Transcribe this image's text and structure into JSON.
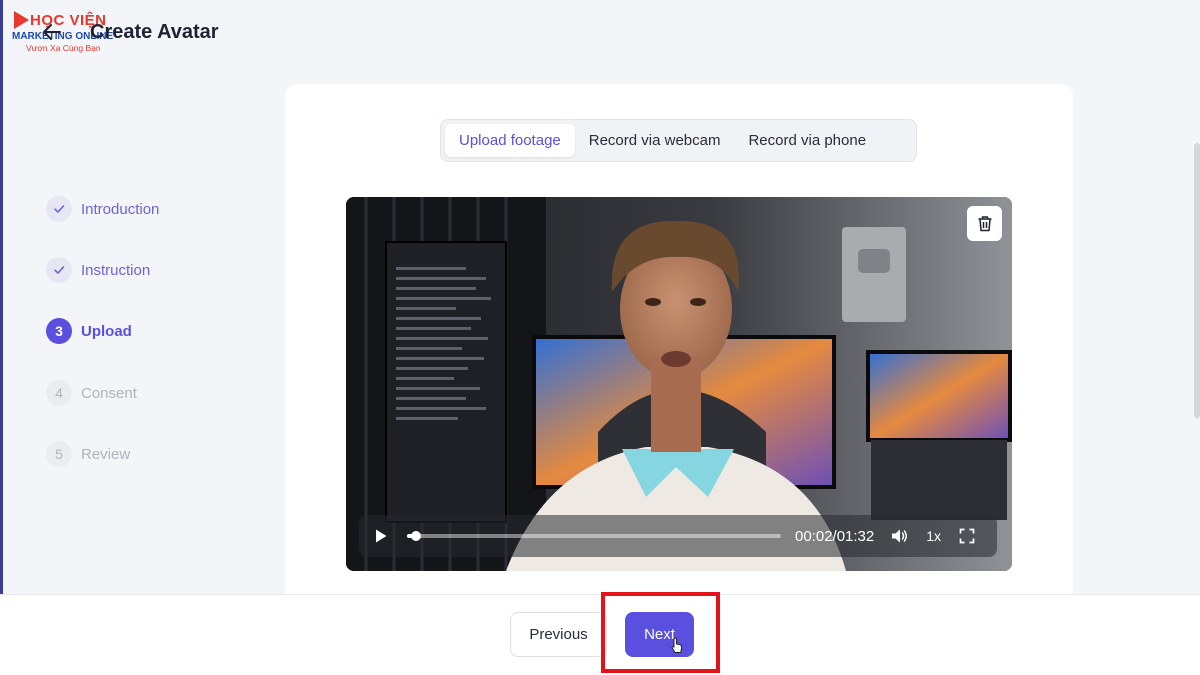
{
  "logo": {
    "line1": "HỌC VIỆN",
    "line2": "MARKETING ONLINE",
    "line3": "Vươn Xa Cùng Bạn"
  },
  "header": {
    "title": "Create Avatar"
  },
  "steps": [
    {
      "number": "1",
      "label": "Introduction",
      "state": "done"
    },
    {
      "number": "2",
      "label": "Instruction",
      "state": "done"
    },
    {
      "number": "3",
      "label": "Upload",
      "state": "active"
    },
    {
      "number": "4",
      "label": "Consent",
      "state": "pending"
    },
    {
      "number": "5",
      "label": "Review",
      "state": "pending"
    }
  ],
  "tabs": [
    {
      "label": "Upload footage",
      "active": true
    },
    {
      "label": "Record via webcam",
      "active": false
    },
    {
      "label": "Record via phone",
      "active": false
    }
  ],
  "video": {
    "time": "00:02/01:32",
    "speed": "1x",
    "progress_fraction": 0.024
  },
  "footer": {
    "previous_label": "Previous",
    "next_label": "Next"
  },
  "colors": {
    "accent": "#5b4fe0",
    "highlight": "#e4121b",
    "done": "#6d63d8",
    "pending": "#b0b3bc"
  }
}
